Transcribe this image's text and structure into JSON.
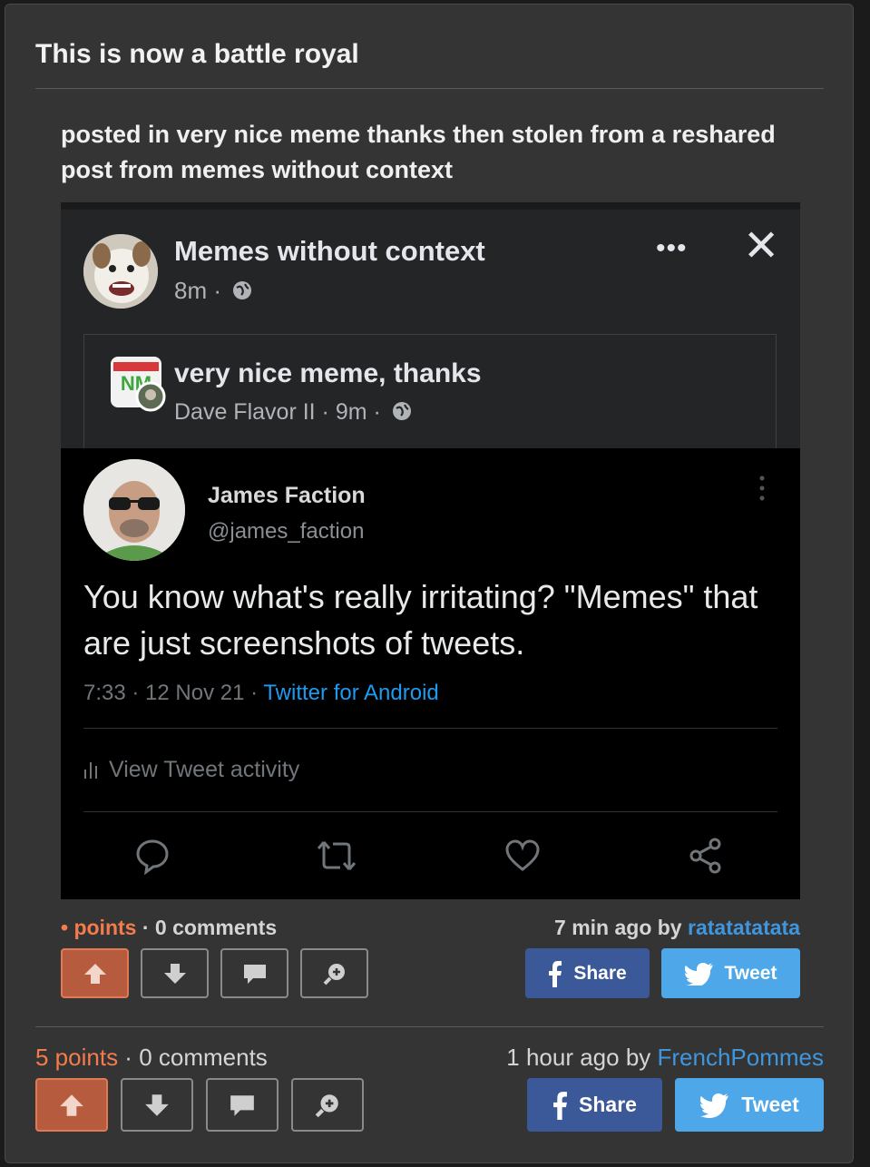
{
  "post": {
    "title": "This is now a battle royal",
    "subtitle": "posted in very nice meme thanks then stolen from a reshared post from memes without context"
  },
  "screenshot": {
    "fb_page_name": "Memes without context",
    "fb_page_meta": "8m ·",
    "group_name": "very nice meme, thanks",
    "group_meta": "Dave Flavor II · 9m ·",
    "tweet": {
      "name": "James Faction",
      "handle": "@james_faction",
      "text": "You know what's really irritating? \"Memes\" that are just screenshots of tweets.",
      "meta_prefix": "7:33 · 12 Nov 21 · ",
      "meta_source": "Twitter for Android",
      "activity": "View Tweet activity"
    }
  },
  "inner_post": {
    "points_label": "points",
    "points_prefix": "• ",
    "comments": "0 comments",
    "time": "7 min ago by ",
    "user": "ratatatatata",
    "share": "Share",
    "tweet": "Tweet"
  },
  "outer_post": {
    "points_label": "5 points",
    "comments": "0 comments",
    "time": "1 hour ago by ",
    "user": "FrenchPommes",
    "share": "Share",
    "tweet": "Tweet"
  },
  "colors": {
    "accent_points": "#f47c4c",
    "user_link": "#3f96dd",
    "facebook": "#3b5998",
    "twitter": "#4da7e8"
  }
}
